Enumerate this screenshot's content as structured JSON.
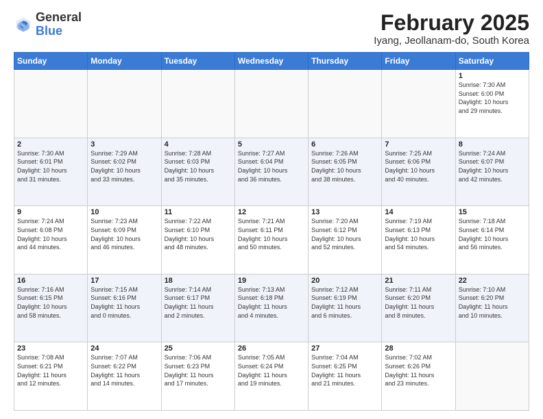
{
  "header": {
    "logo_general": "General",
    "logo_blue": "Blue",
    "month_title": "February 2025",
    "location": "Iyang, Jeollanam-do, South Korea"
  },
  "days_of_week": [
    "Sunday",
    "Monday",
    "Tuesday",
    "Wednesday",
    "Thursday",
    "Friday",
    "Saturday"
  ],
  "weeks": [
    [
      {
        "num": "",
        "info": ""
      },
      {
        "num": "",
        "info": ""
      },
      {
        "num": "",
        "info": ""
      },
      {
        "num": "",
        "info": ""
      },
      {
        "num": "",
        "info": ""
      },
      {
        "num": "",
        "info": ""
      },
      {
        "num": "1",
        "info": "Sunrise: 7:30 AM\nSunset: 6:00 PM\nDaylight: 10 hours\nand 29 minutes."
      }
    ],
    [
      {
        "num": "2",
        "info": "Sunrise: 7:30 AM\nSunset: 6:01 PM\nDaylight: 10 hours\nand 31 minutes."
      },
      {
        "num": "3",
        "info": "Sunrise: 7:29 AM\nSunset: 6:02 PM\nDaylight: 10 hours\nand 33 minutes."
      },
      {
        "num": "4",
        "info": "Sunrise: 7:28 AM\nSunset: 6:03 PM\nDaylight: 10 hours\nand 35 minutes."
      },
      {
        "num": "5",
        "info": "Sunrise: 7:27 AM\nSunset: 6:04 PM\nDaylight: 10 hours\nand 36 minutes."
      },
      {
        "num": "6",
        "info": "Sunrise: 7:26 AM\nSunset: 6:05 PM\nDaylight: 10 hours\nand 38 minutes."
      },
      {
        "num": "7",
        "info": "Sunrise: 7:25 AM\nSunset: 6:06 PM\nDaylight: 10 hours\nand 40 minutes."
      },
      {
        "num": "8",
        "info": "Sunrise: 7:24 AM\nSunset: 6:07 PM\nDaylight: 10 hours\nand 42 minutes."
      }
    ],
    [
      {
        "num": "9",
        "info": "Sunrise: 7:24 AM\nSunset: 6:08 PM\nDaylight: 10 hours\nand 44 minutes."
      },
      {
        "num": "10",
        "info": "Sunrise: 7:23 AM\nSunset: 6:09 PM\nDaylight: 10 hours\nand 46 minutes."
      },
      {
        "num": "11",
        "info": "Sunrise: 7:22 AM\nSunset: 6:10 PM\nDaylight: 10 hours\nand 48 minutes."
      },
      {
        "num": "12",
        "info": "Sunrise: 7:21 AM\nSunset: 6:11 PM\nDaylight: 10 hours\nand 50 minutes."
      },
      {
        "num": "13",
        "info": "Sunrise: 7:20 AM\nSunset: 6:12 PM\nDaylight: 10 hours\nand 52 minutes."
      },
      {
        "num": "14",
        "info": "Sunrise: 7:19 AM\nSunset: 6:13 PM\nDaylight: 10 hours\nand 54 minutes."
      },
      {
        "num": "15",
        "info": "Sunrise: 7:18 AM\nSunset: 6:14 PM\nDaylight: 10 hours\nand 56 minutes."
      }
    ],
    [
      {
        "num": "16",
        "info": "Sunrise: 7:16 AM\nSunset: 6:15 PM\nDaylight: 10 hours\nand 58 minutes."
      },
      {
        "num": "17",
        "info": "Sunrise: 7:15 AM\nSunset: 6:16 PM\nDaylight: 11 hours\nand 0 minutes."
      },
      {
        "num": "18",
        "info": "Sunrise: 7:14 AM\nSunset: 6:17 PM\nDaylight: 11 hours\nand 2 minutes."
      },
      {
        "num": "19",
        "info": "Sunrise: 7:13 AM\nSunset: 6:18 PM\nDaylight: 11 hours\nand 4 minutes."
      },
      {
        "num": "20",
        "info": "Sunrise: 7:12 AM\nSunset: 6:19 PM\nDaylight: 11 hours\nand 6 minutes."
      },
      {
        "num": "21",
        "info": "Sunrise: 7:11 AM\nSunset: 6:20 PM\nDaylight: 11 hours\nand 8 minutes."
      },
      {
        "num": "22",
        "info": "Sunrise: 7:10 AM\nSunset: 6:20 PM\nDaylight: 11 hours\nand 10 minutes."
      }
    ],
    [
      {
        "num": "23",
        "info": "Sunrise: 7:08 AM\nSunset: 6:21 PM\nDaylight: 11 hours\nand 12 minutes."
      },
      {
        "num": "24",
        "info": "Sunrise: 7:07 AM\nSunset: 6:22 PM\nDaylight: 11 hours\nand 14 minutes."
      },
      {
        "num": "25",
        "info": "Sunrise: 7:06 AM\nSunset: 6:23 PM\nDaylight: 11 hours\nand 17 minutes."
      },
      {
        "num": "26",
        "info": "Sunrise: 7:05 AM\nSunset: 6:24 PM\nDaylight: 11 hours\nand 19 minutes."
      },
      {
        "num": "27",
        "info": "Sunrise: 7:04 AM\nSunset: 6:25 PM\nDaylight: 11 hours\nand 21 minutes."
      },
      {
        "num": "28",
        "info": "Sunrise: 7:02 AM\nSunset: 6:26 PM\nDaylight: 11 hours\nand 23 minutes."
      },
      {
        "num": "",
        "info": ""
      }
    ]
  ]
}
